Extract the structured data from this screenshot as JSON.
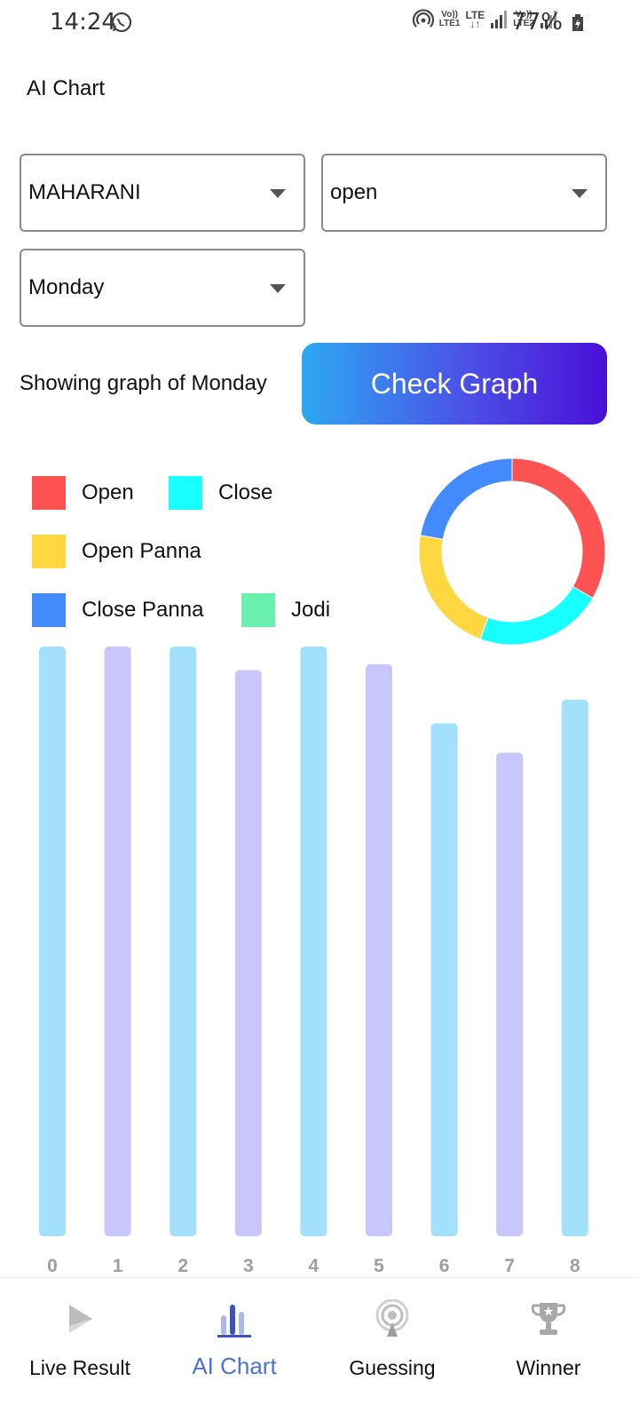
{
  "status_bar": {
    "time": "14:24",
    "net1_top": "Vo))",
    "net1_bottom": "LTE1",
    "lte": "LTE",
    "net2_top": "Vo))",
    "net2_bottom": "LTE2",
    "battery": "77%"
  },
  "header": {
    "title": "AI Chart"
  },
  "filters": {
    "market": "MAHARANI",
    "session": "open",
    "day": "Monday"
  },
  "action": {
    "showing_text": "Showing graph of Monday",
    "check_button": "Check Graph"
  },
  "legend": [
    {
      "label": "Open",
      "color": "#ff5252"
    },
    {
      "label": "Close",
      "color": "#18ffff"
    },
    {
      "label": "Open Panna",
      "color": "#ffd740"
    },
    {
      "label": "Close Panna",
      "color": "#448aff"
    },
    {
      "label": "Jodi",
      "color": "#69f0ae"
    }
  ],
  "chart_data": [
    {
      "type": "pie",
      "style": "donut",
      "labels": [
        "Open",
        "Close",
        "Open Panna",
        "Close Panna"
      ],
      "values": [
        30,
        20,
        20,
        20
      ],
      "colors": [
        "#ff5252",
        "#18ffff",
        "#ffd740",
        "#448aff"
      ]
    },
    {
      "type": "bar",
      "categories": [
        "0",
        "1",
        "2",
        "3",
        "4",
        "5",
        "6",
        "7",
        "8"
      ],
      "values": [
        100,
        100,
        100,
        96,
        100,
        97,
        87,
        82,
        91
      ],
      "ylim": [
        0,
        100
      ],
      "grid": false,
      "bar_colors": [
        "#a3e0fb",
        "#c9c6fb"
      ]
    }
  ],
  "bottom_nav": [
    {
      "label": "Live Result",
      "icon": "play-icon",
      "active": false
    },
    {
      "label": "AI Chart",
      "icon": "bar-chart-icon",
      "active": true
    },
    {
      "label": "Guessing",
      "icon": "broadcast-icon",
      "active": false
    },
    {
      "label": "Winner",
      "icon": "trophy-icon",
      "active": false
    }
  ]
}
